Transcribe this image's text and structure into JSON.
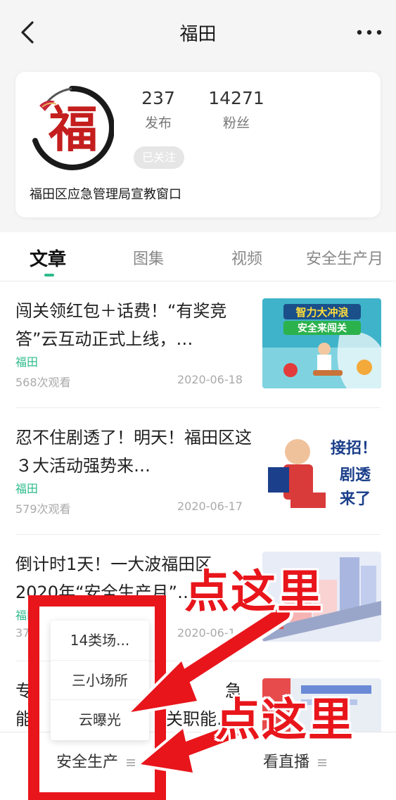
{
  "navbar": {
    "title": "福田"
  },
  "profile": {
    "logo_char": "福",
    "stats": [
      {
        "value": "237",
        "label": "发布"
      },
      {
        "value": "14271",
        "label": "粉丝"
      }
    ],
    "follow_status": "已关注",
    "account_name": "福田区应急管理局宣教窗口"
  },
  "tabs": [
    {
      "label": "文章",
      "active": true
    },
    {
      "label": "图集",
      "active": false
    },
    {
      "label": "视频",
      "active": false
    },
    {
      "label": "安全生产月",
      "active": false
    }
  ],
  "articles": [
    {
      "title": "闯关领红包＋话费！“有奖竞答”云互动正式上线，…",
      "source": "福田",
      "views": "568次观看",
      "date": "2020-06-18",
      "thumb_text_1": "智力大冲浪",
      "thumb_text_2": "安全来闯关"
    },
    {
      "title": "忍不住剧透了！明天！福田区这３大活动强势来…",
      "source": "福田",
      "views": "579次观看",
      "date": "2020-06-17",
      "thumb_text_1": "接招！",
      "thumb_text_2": "剧透",
      "thumb_text_3": "来了"
    },
    {
      "title": "倒计时1天！一大波福田区2020年“安全生产月”…",
      "source": "福田",
      "views": "37",
      "date": "2020-06-1"
    },
    {
      "title": "专",
      "title_tail": "急",
      "title_line2_start": "能",
      "title_line2_end": "关职能…"
    }
  ],
  "bottom_bar": {
    "left_label": "安全生产",
    "right_label": "看直播"
  },
  "popup_menu": {
    "items": [
      "14类场...",
      "三小场所",
      "云曝光"
    ]
  },
  "annotations": {
    "label_1": "点这里",
    "label_2": "点这里",
    "color": "#e8151b"
  },
  "colors": {
    "accent": "#2dbb8b",
    "annotation": "#e8151b"
  }
}
